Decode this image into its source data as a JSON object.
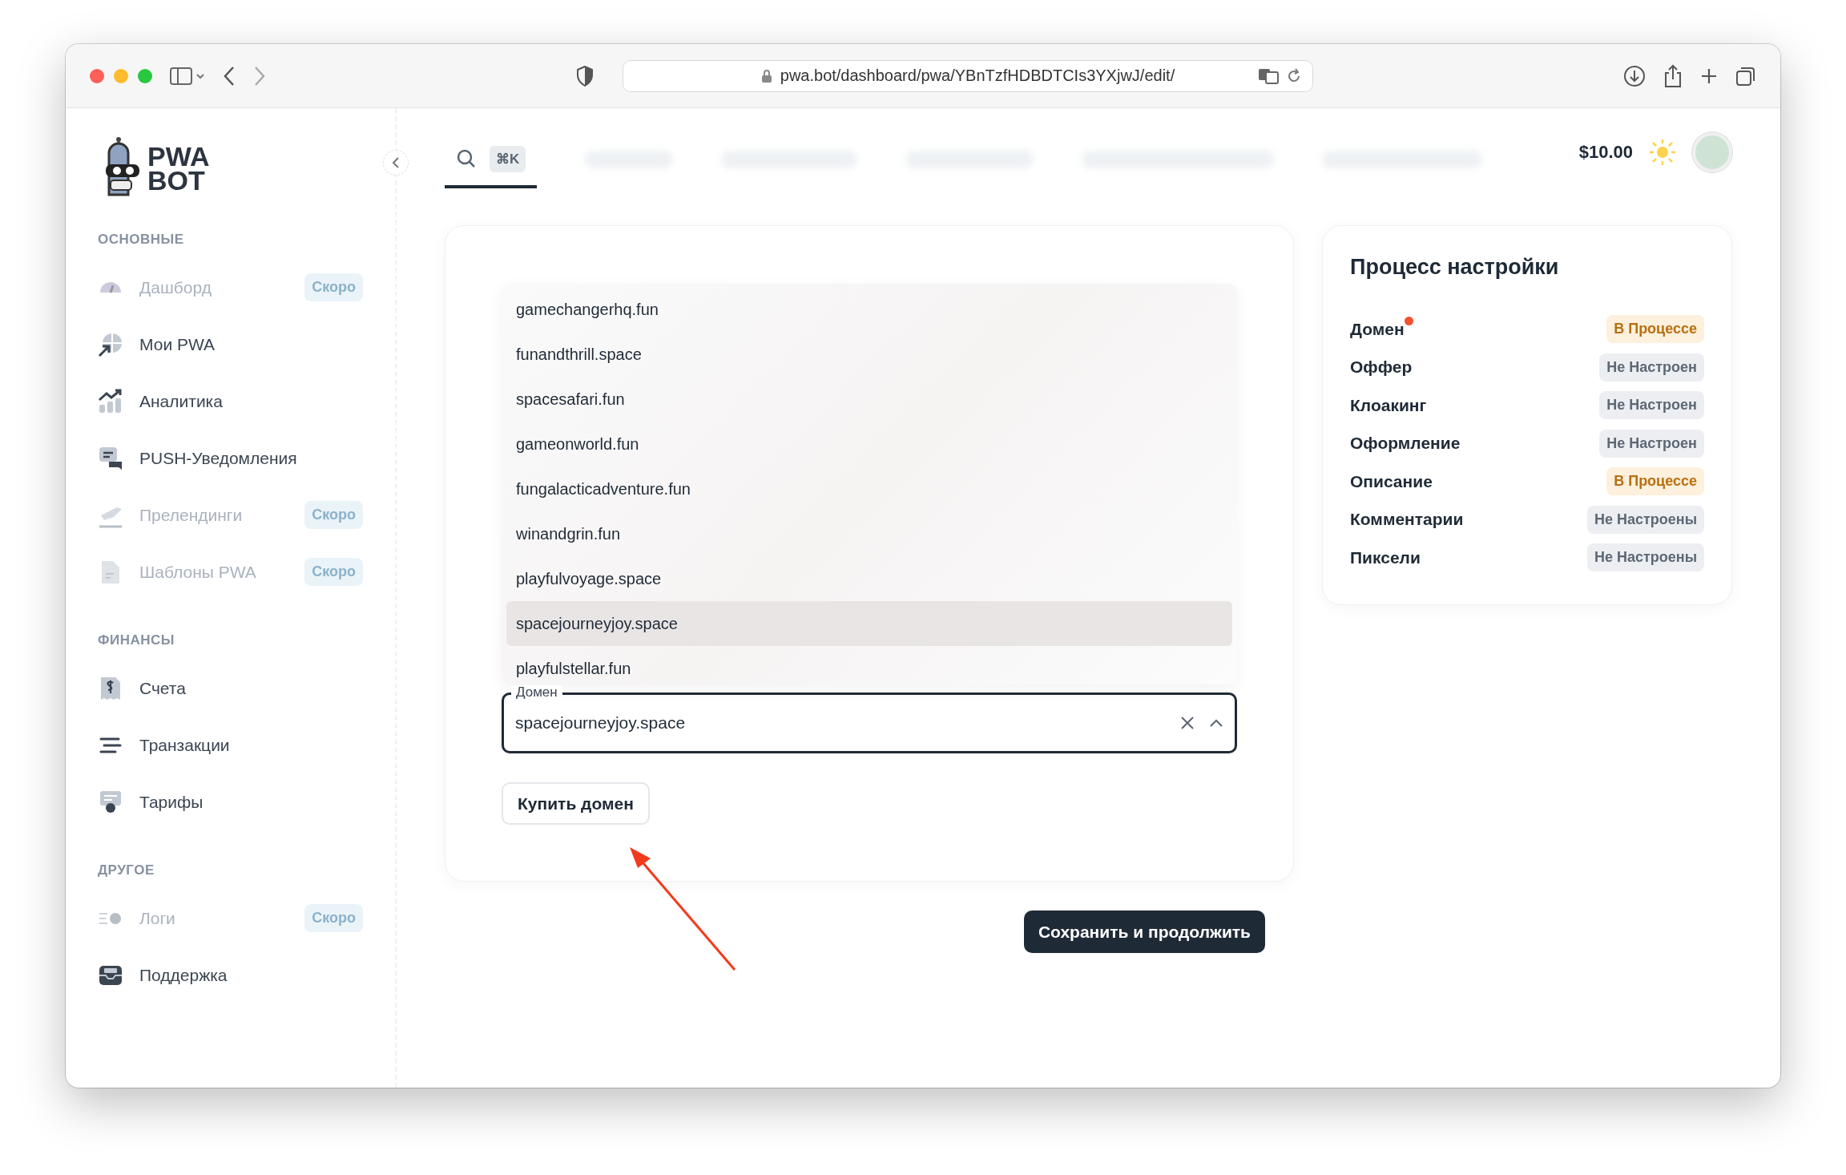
{
  "browser": {
    "url": "pwa.bot/dashboard/pwa/YBnTzfHDBDTCIs3YXjwJ/edit/"
  },
  "logo": {
    "line1": "PWA",
    "line2": "BOT"
  },
  "sidebar": {
    "sections": [
      {
        "title": "ОСНОВНЫЕ",
        "items": [
          {
            "label": "Дашборд",
            "kind": "gauge",
            "disabled": true,
            "badge": "Скоро"
          },
          {
            "label": "Мои PWA",
            "kind": "globe",
            "disabled": false
          },
          {
            "label": "Аналитика",
            "kind": "chart",
            "disabled": false
          },
          {
            "label": "PUSH-Уведомления",
            "kind": "chat",
            "disabled": false
          },
          {
            "label": "Прелендинги",
            "kind": "plane",
            "disabled": true,
            "badge": "Скоро"
          },
          {
            "label": "Шаблоны PWA",
            "kind": "doc",
            "disabled": true,
            "badge": "Скоро"
          }
        ]
      },
      {
        "title": "ФИНАНСЫ",
        "items": [
          {
            "label": "Счета",
            "kind": "invoice",
            "disabled": false
          },
          {
            "label": "Транзакции",
            "kind": "lines",
            "disabled": false
          },
          {
            "label": "Тарифы",
            "kind": "certificate",
            "disabled": false
          }
        ]
      },
      {
        "title": "ДРУГОЕ",
        "items": [
          {
            "label": "Логи",
            "kind": "log",
            "disabled": true,
            "badge": "Скоро"
          },
          {
            "label": "Поддержка",
            "kind": "inbox",
            "disabled": false
          }
        ]
      }
    ]
  },
  "topbar": {
    "shortcut": "⌘K",
    "balance": "$10.00"
  },
  "domain_form": {
    "options": [
      {
        "label": "gamechangerhq.fun",
        "selected": false
      },
      {
        "label": "funandthrill.space",
        "selected": false
      },
      {
        "label": "spacesafari.fun",
        "selected": false
      },
      {
        "label": "gameonworld.fun",
        "selected": false
      },
      {
        "label": "fungalacticadventure.fun",
        "selected": false
      },
      {
        "label": "winandgrin.fun",
        "selected": false
      },
      {
        "label": "playfulvoyage.space",
        "selected": false
      },
      {
        "label": "spacejourneyjoy.space",
        "selected": true
      },
      {
        "label": "playfulstellar.fun",
        "selected": false
      }
    ],
    "field_label": "Домен",
    "value": "spacejourneyjoy.space",
    "buy_button": "Купить домен"
  },
  "save_button": "Сохранить и продолжить",
  "progress": {
    "title": "Процесс настройки",
    "steps": [
      {
        "label": "Домен",
        "alert": true,
        "status": "В Процессе",
        "kind": "in_progress"
      },
      {
        "label": "Оффер",
        "alert": false,
        "status": "Не Настроен",
        "kind": "not_set"
      },
      {
        "label": "Клоакинг",
        "alert": false,
        "status": "Не Настроен",
        "kind": "not_set"
      },
      {
        "label": "Оформление",
        "alert": false,
        "status": "Не Настроен",
        "kind": "not_set"
      },
      {
        "label": "Описание",
        "alert": false,
        "status": "В Процессе",
        "kind": "in_progress"
      },
      {
        "label": "Комментарии",
        "alert": false,
        "status": "Не Настроены",
        "kind": "not_set"
      },
      {
        "label": "Пиксели",
        "alert": false,
        "status": "Не Настроены",
        "kind": "not_set"
      }
    ]
  }
}
